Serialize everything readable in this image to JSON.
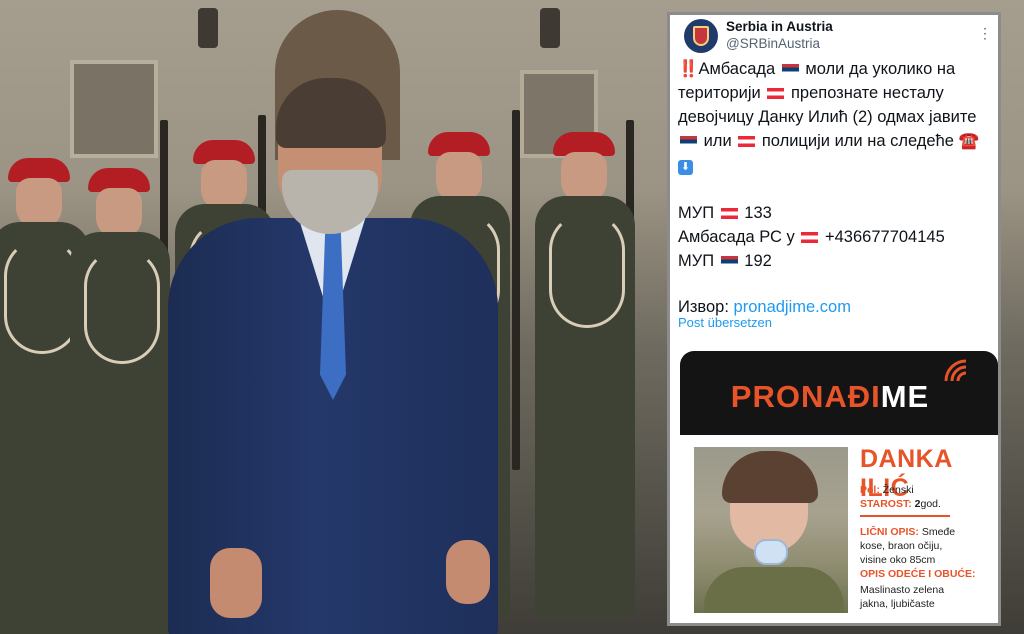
{
  "tweet": {
    "account_name": "Serbia in Austria",
    "handle": "@SRBinAustria",
    "more_icon": "⋮",
    "alert_icon": "‼️",
    "line1": "Амбасада",
    "line1b": "моли да уколико на",
    "line2": "територији",
    "line2b": "препознате несталу",
    "line3": "девојчицу Данку Илић (2) одмах јавите",
    "line4b": "или",
    "line4c": "полицији или на следеће",
    "phone_icon": "☎️",
    "down_icon": "⬇",
    "mup_at_label": "МУП",
    "mup_at_number": "133",
    "embassy_label": "Амбасада РС у",
    "embassy_number": "+436677704145",
    "mup_rs_label": "МУП",
    "mup_rs_number": "192",
    "source_label": "Извор:",
    "source_link": "pronadjime.com",
    "translate_label": "Post übersetzen"
  },
  "poster": {
    "logo_left": "PRONAĐI",
    "logo_right": "ME",
    "name": "DANKA ILIĆ",
    "sex_label": "Pol:",
    "sex_value": "Ženski",
    "age_label": "STAROST:",
    "age_number": "2",
    "age_unit": "god.",
    "desc_label": "LIČNI OPIS:",
    "desc_value_1": "Smeđe",
    "desc_value_2": "kose, braon očiju,",
    "desc_value_3": "visine oko 85cm",
    "clothes_label": "OPIS ODEĆE I OBUĆE:",
    "clothes_value_1": "Maslinasto zelena",
    "clothes_value_2": "jakna, ljubičaste"
  },
  "colors": {
    "link": "#1d9bf0",
    "poster_accent": "#e8542a",
    "poster_dark": "#141414"
  }
}
